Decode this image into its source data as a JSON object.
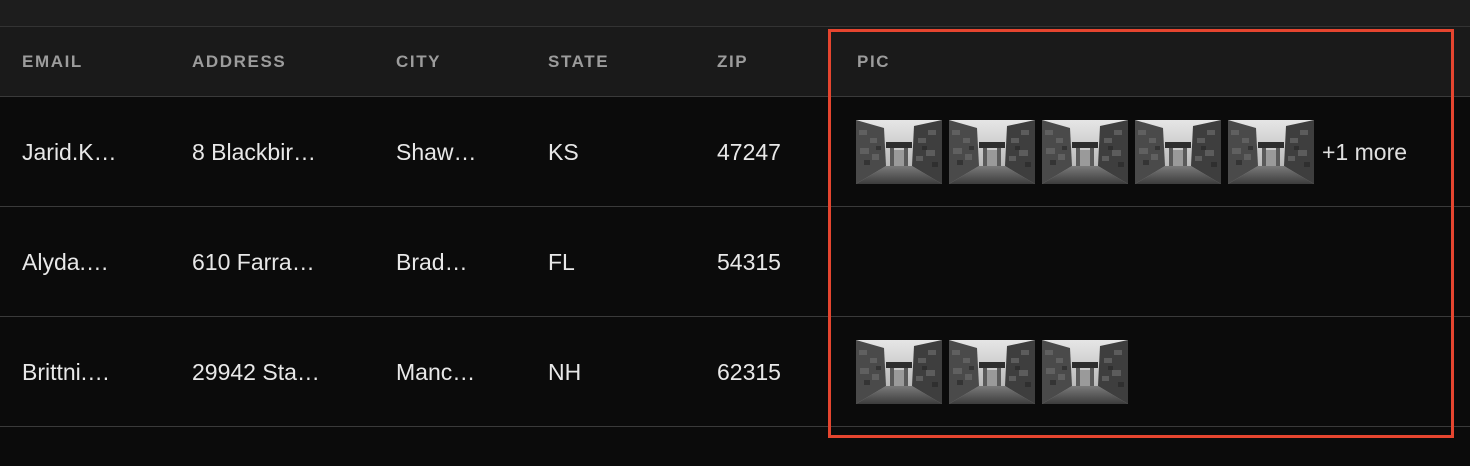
{
  "table": {
    "headers": {
      "email": "EMAIL",
      "address": "ADDRESS",
      "city": "CITY",
      "state": "STATE",
      "zip": "ZIP",
      "pic": "PIC"
    },
    "rows": [
      {
        "email": "Jarid.K…",
        "address": "8 Blackbir…",
        "city": "Shaw…",
        "state": "KS",
        "zip": "47247",
        "pic_count": 5,
        "more_label": "+1 more"
      },
      {
        "email": "Alyda.…",
        "address": "610 Farra…",
        "city": "Brad…",
        "state": "FL",
        "zip": "54315",
        "pic_count": 0,
        "more_label": ""
      },
      {
        "email": "Brittni.…",
        "address": "29942 Sta…",
        "city": "Manc…",
        "state": "NH",
        "zip": "62315",
        "pic_count": 3,
        "more_label": ""
      }
    ]
  },
  "colors": {
    "highlight": "#e5452f",
    "background": "#0b0b0b",
    "header_bg": "#1a1a1a"
  },
  "icons": {
    "thumbnail": "alley-photo-thumbnail"
  }
}
